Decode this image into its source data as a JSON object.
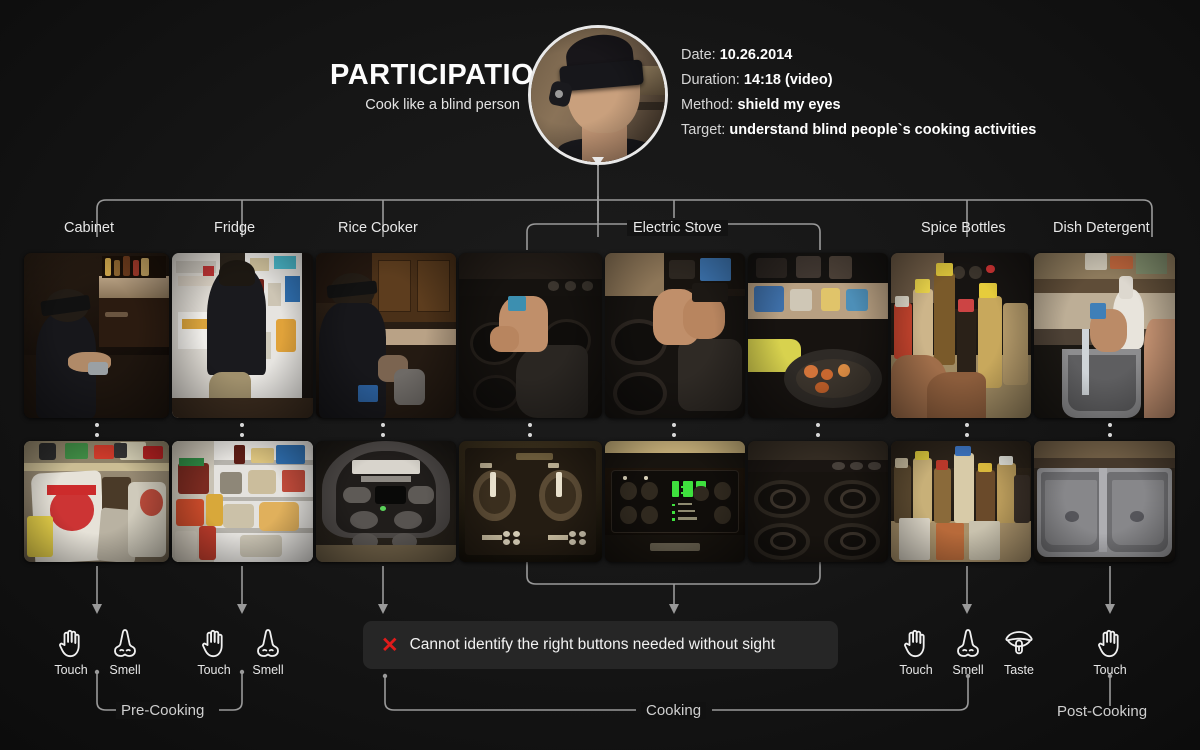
{
  "header": {
    "title": "PARTICIPATION",
    "subtitle": "Cook like a blind person",
    "avatar_alt": "blindfolded-participant",
    "meta": [
      {
        "label": "Date:",
        "value": "10.26.2014"
      },
      {
        "label": "Duration:",
        "value": "14:18 (video)"
      },
      {
        "label": "Method:",
        "value": "shield my eyes"
      },
      {
        "label": "Target:",
        "value": "understand blind people`s cooking activities"
      }
    ]
  },
  "categories": [
    {
      "id": "cabinet",
      "label": "Cabinet"
    },
    {
      "id": "fridge",
      "label": "Fridge"
    },
    {
      "id": "rice-cooker",
      "label": "Rice Cooker"
    },
    {
      "id": "electric-stove",
      "label": "Electric Stove"
    },
    {
      "id": "spice-bottles",
      "label": "Spice Bottles"
    },
    {
      "id": "dish-detergent",
      "label": "Dish Detergent"
    }
  ],
  "photos_row1": [
    {
      "id": "cabinet-search",
      "caption": "person kneeling searching under kitchen cabinet"
    },
    {
      "id": "fridge-open",
      "caption": "person kneeling in front of open refrigerator"
    },
    {
      "id": "rice-cooker-use",
      "caption": "person at counter operating rice cooker"
    },
    {
      "id": "stove-reach",
      "caption": "hand reaching across electric stove burner"
    },
    {
      "id": "stove-pan-lift",
      "caption": "hands lifting pan onto electric stove"
    },
    {
      "id": "stove-cooking",
      "caption": "cooking food in pan on electric stove"
    },
    {
      "id": "spice-grab",
      "caption": "hand grabbing a bottle among many spice bottles"
    },
    {
      "id": "detergent-sink",
      "caption": "hands with detergent bottle at kitchen sink"
    }
  ],
  "photos_row2": [
    {
      "id": "cabinet-contents",
      "caption": "close-up of cabinet contents, rice bag and snacks"
    },
    {
      "id": "fridge-contents",
      "caption": "close-up of refrigerator shelves with food"
    },
    {
      "id": "rice-cooker-panel",
      "caption": "AROMA rice cooker control panel"
    },
    {
      "id": "stove-knobs",
      "caption": "electric stove control knobs marked OFF lo med hi"
    },
    {
      "id": "oven-panel",
      "caption": "Frigidaire oven control panel with clock 1:42"
    },
    {
      "id": "stove-burners",
      "caption": "electric stove coil burners close-up"
    },
    {
      "id": "spice-shelf",
      "caption": "spice bottles crowded on the counter"
    },
    {
      "id": "sink-basin",
      "caption": "stainless steel double sink basin"
    }
  ],
  "warning": {
    "icon": "x-mark-icon",
    "text": "Cannot identify the right buttons needed without sight",
    "color": "#e01b1b"
  },
  "senses": [
    {
      "group": "cabinet",
      "icon": "hand-icon",
      "label": "Touch"
    },
    {
      "group": "cabinet",
      "icon": "nose-icon",
      "label": "Smell"
    },
    {
      "group": "fridge",
      "icon": "hand-icon",
      "label": "Touch"
    },
    {
      "group": "fridge",
      "icon": "nose-icon",
      "label": "Smell"
    },
    {
      "group": "spice",
      "icon": "hand-icon",
      "label": "Touch"
    },
    {
      "group": "spice",
      "icon": "nose-icon",
      "label": "Smell"
    },
    {
      "group": "spice",
      "icon": "mouth-icon",
      "label": "Taste"
    },
    {
      "group": "detergent",
      "icon": "hand-icon",
      "label": "Touch"
    }
  ],
  "phases": [
    {
      "id": "pre-cooking",
      "label": "Pre-Cooking"
    },
    {
      "id": "cooking",
      "label": "Cooking"
    },
    {
      "id": "post-cooking",
      "label": "Post-Cooking"
    }
  ],
  "colors": {
    "background": "#121212",
    "line": "#9a9a9a",
    "text": "#e8e8e8",
    "accent_red": "#e01b1b"
  }
}
